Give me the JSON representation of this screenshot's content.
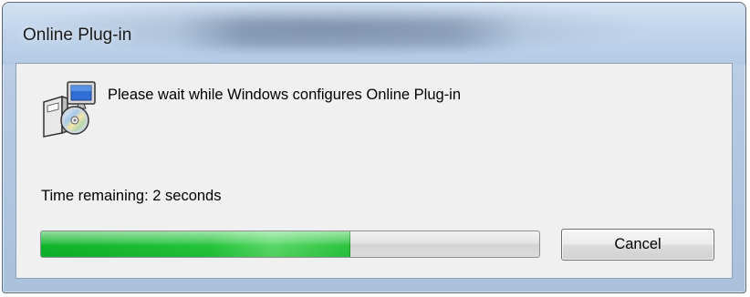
{
  "window": {
    "title": "Online Plug-in"
  },
  "dialog": {
    "icon": "installer-icon",
    "message": "Please wait while Windows configures Online Plug-in",
    "time_remaining": "Time remaining: 2 seconds",
    "progress_fraction": 0.62,
    "cancel_label": "Cancel"
  },
  "colors": {
    "progress_green": "#24c43a",
    "content_background": "#f0f0f0",
    "titlebar_blue": "#c1d5ec"
  }
}
